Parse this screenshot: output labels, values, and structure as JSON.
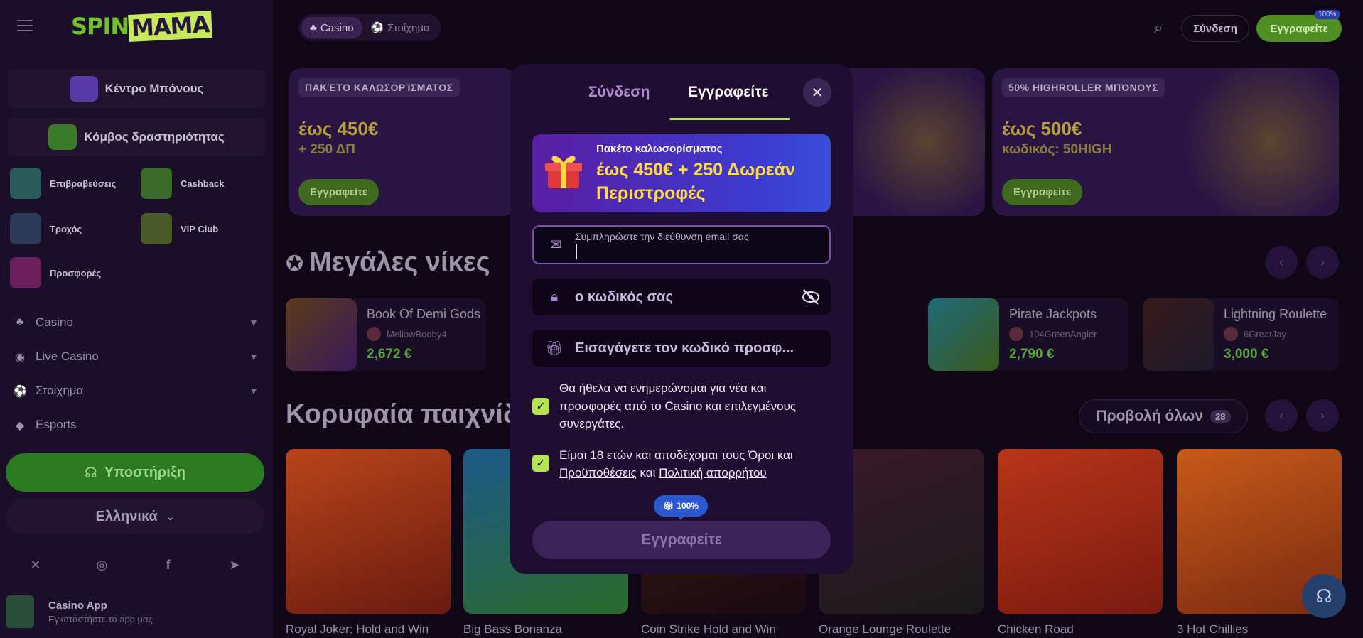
{
  "brand": {
    "logo_a": "SPIN",
    "logo_b": "MAMA"
  },
  "header": {
    "tabs": [
      {
        "label": "Casino"
      },
      {
        "label": "Στοίχημα"
      }
    ],
    "login_label": "Σύνδεση",
    "register_label": "Εγγραφείτε",
    "register_badge": "100%"
  },
  "sidebar": {
    "bonus_center": "Κέντρο Μπόνους",
    "activity_hub": "Κόμβος δραστηριότητας",
    "tiles": [
      {
        "label": "Επιβραβεύσεις"
      },
      {
        "label": "Cashback"
      },
      {
        "label": "Τροχός"
      },
      {
        "label": "VIP Club"
      },
      {
        "label": "Προσφορές"
      }
    ],
    "nav": [
      {
        "label": "Casino"
      },
      {
        "label": "Live Casino"
      },
      {
        "label": "Στοίχημα"
      },
      {
        "label": "Esports"
      }
    ],
    "support_label": "Υποστήριξη",
    "language_label": "Ελληνικά",
    "app_title": "Casino App",
    "app_subtitle": "Εγκαταστήστε το app μας"
  },
  "banners": [
    {
      "tag": "ΠΑΚΈΤΟ ΚΑΛΩΣΟΡΊΣΜΑΤΟΣ",
      "amount": "έως 450€",
      "sub": "+ 250 ΔΠ",
      "button": "Εγγραφείτε"
    },
    {
      "tag": "50% HIGHROLLER ΜΠΌΝΟΥΣ",
      "amount": "έως 500€",
      "sub": "κωδικός: 50HIGH",
      "button": "Εγγραφείτε"
    }
  ],
  "big_wins": {
    "title": "Μεγάλες νίκες",
    "items": [
      {
        "game": "Book Of Demi Gods",
        "user": "MellowBooby4",
        "amount": "2,672 €"
      },
      {
        "game": "Pirate Jackpots",
        "user": "104GreenAngler",
        "amount": "2,790 €"
      },
      {
        "game": "Lightning Roulette",
        "user": "6GreatJay",
        "amount": "3,000 €"
      }
    ]
  },
  "top_games": {
    "title": "Κορυφαία παιχνίδια",
    "view_all": "Προβολή όλων",
    "count": "28",
    "items": [
      {
        "name": "Royal Joker: Hold and Win"
      },
      {
        "name": "Big Bass Bonanza"
      },
      {
        "name": "Coin Strike Hold and Win"
      },
      {
        "name": "Orange Lounge Roulette"
      },
      {
        "name": "Chicken Road"
      },
      {
        "name": "3 Hot Chillies"
      }
    ]
  },
  "modal": {
    "tab_login": "Σύνδεση",
    "tab_register": "Εγγραφείτε",
    "promo_title": "Πακέτο καλωσορίσματος",
    "promo_main": "έως 450€ + 250 Δωρεάν Περιστροφές",
    "email_label": "Συμπληρώστε την διεύθυνση email σας",
    "email_value": "",
    "password_placeholder": "ο κωδικός σας",
    "promo_code_placeholder": "Εισαγάγετε τον κωδικό προσφ...",
    "newsletter_text": "Θα ήθελα να ενημερώνομαι για νέα και προσφορές από το Casino και επιλεγμένους συνεργάτες.",
    "terms_prefix": "Είμαι 18 ετών και αποδέχομαι τους ",
    "terms_link": "Όροι και Προϋποθέσεις",
    "terms_middle": " και ",
    "privacy_link": "Πολιτική απορρήτου",
    "badge": "100%",
    "submit_label": "Εγγραφείτε"
  }
}
